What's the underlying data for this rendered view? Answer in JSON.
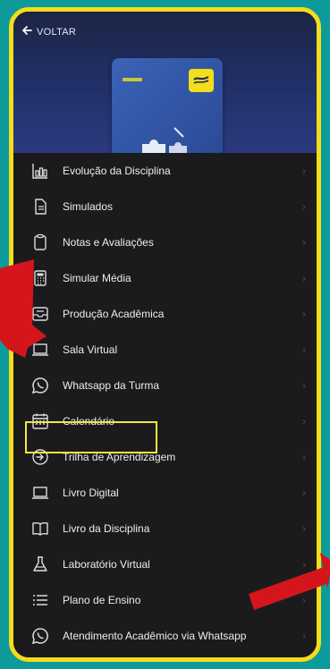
{
  "header": {
    "back_label": "VOLTAR"
  },
  "menu": {
    "items": [
      {
        "label": "Evolução da Disciplina",
        "icon": "bar-chart-icon"
      },
      {
        "label": "Simulados",
        "icon": "document-icon"
      },
      {
        "label": "Notas e Avaliações",
        "icon": "clipboard-icon"
      },
      {
        "label": "Simular Média",
        "icon": "calculator-icon"
      },
      {
        "label": "Produção Acadêmica",
        "icon": "inbox-icon"
      },
      {
        "label": "Sala Virtual",
        "icon": "laptop-icon"
      },
      {
        "label": "Whatsapp da Turma",
        "icon": "whatsapp-icon"
      },
      {
        "label": "Calendário",
        "icon": "calendar-icon"
      },
      {
        "label": "Trilha de Aprendizagem",
        "icon": "arrow-circle-icon"
      },
      {
        "label": "Livro Digital",
        "icon": "laptop-icon"
      },
      {
        "label": "Livro da Disciplina",
        "icon": "book-icon"
      },
      {
        "label": "Laboratório Virtual",
        "icon": "flask-icon"
      },
      {
        "label": "Plano de Ensino",
        "icon": "list-icon"
      },
      {
        "label": "Atendimento Acadêmico via Whatsapp",
        "icon": "whatsapp-icon"
      }
    ]
  },
  "colors": {
    "background_teal": "#0e9a9a",
    "frame_yellow": "#f4dd1a",
    "menu_bg": "#1b1b1d",
    "annotation_red": "#d4161c"
  }
}
